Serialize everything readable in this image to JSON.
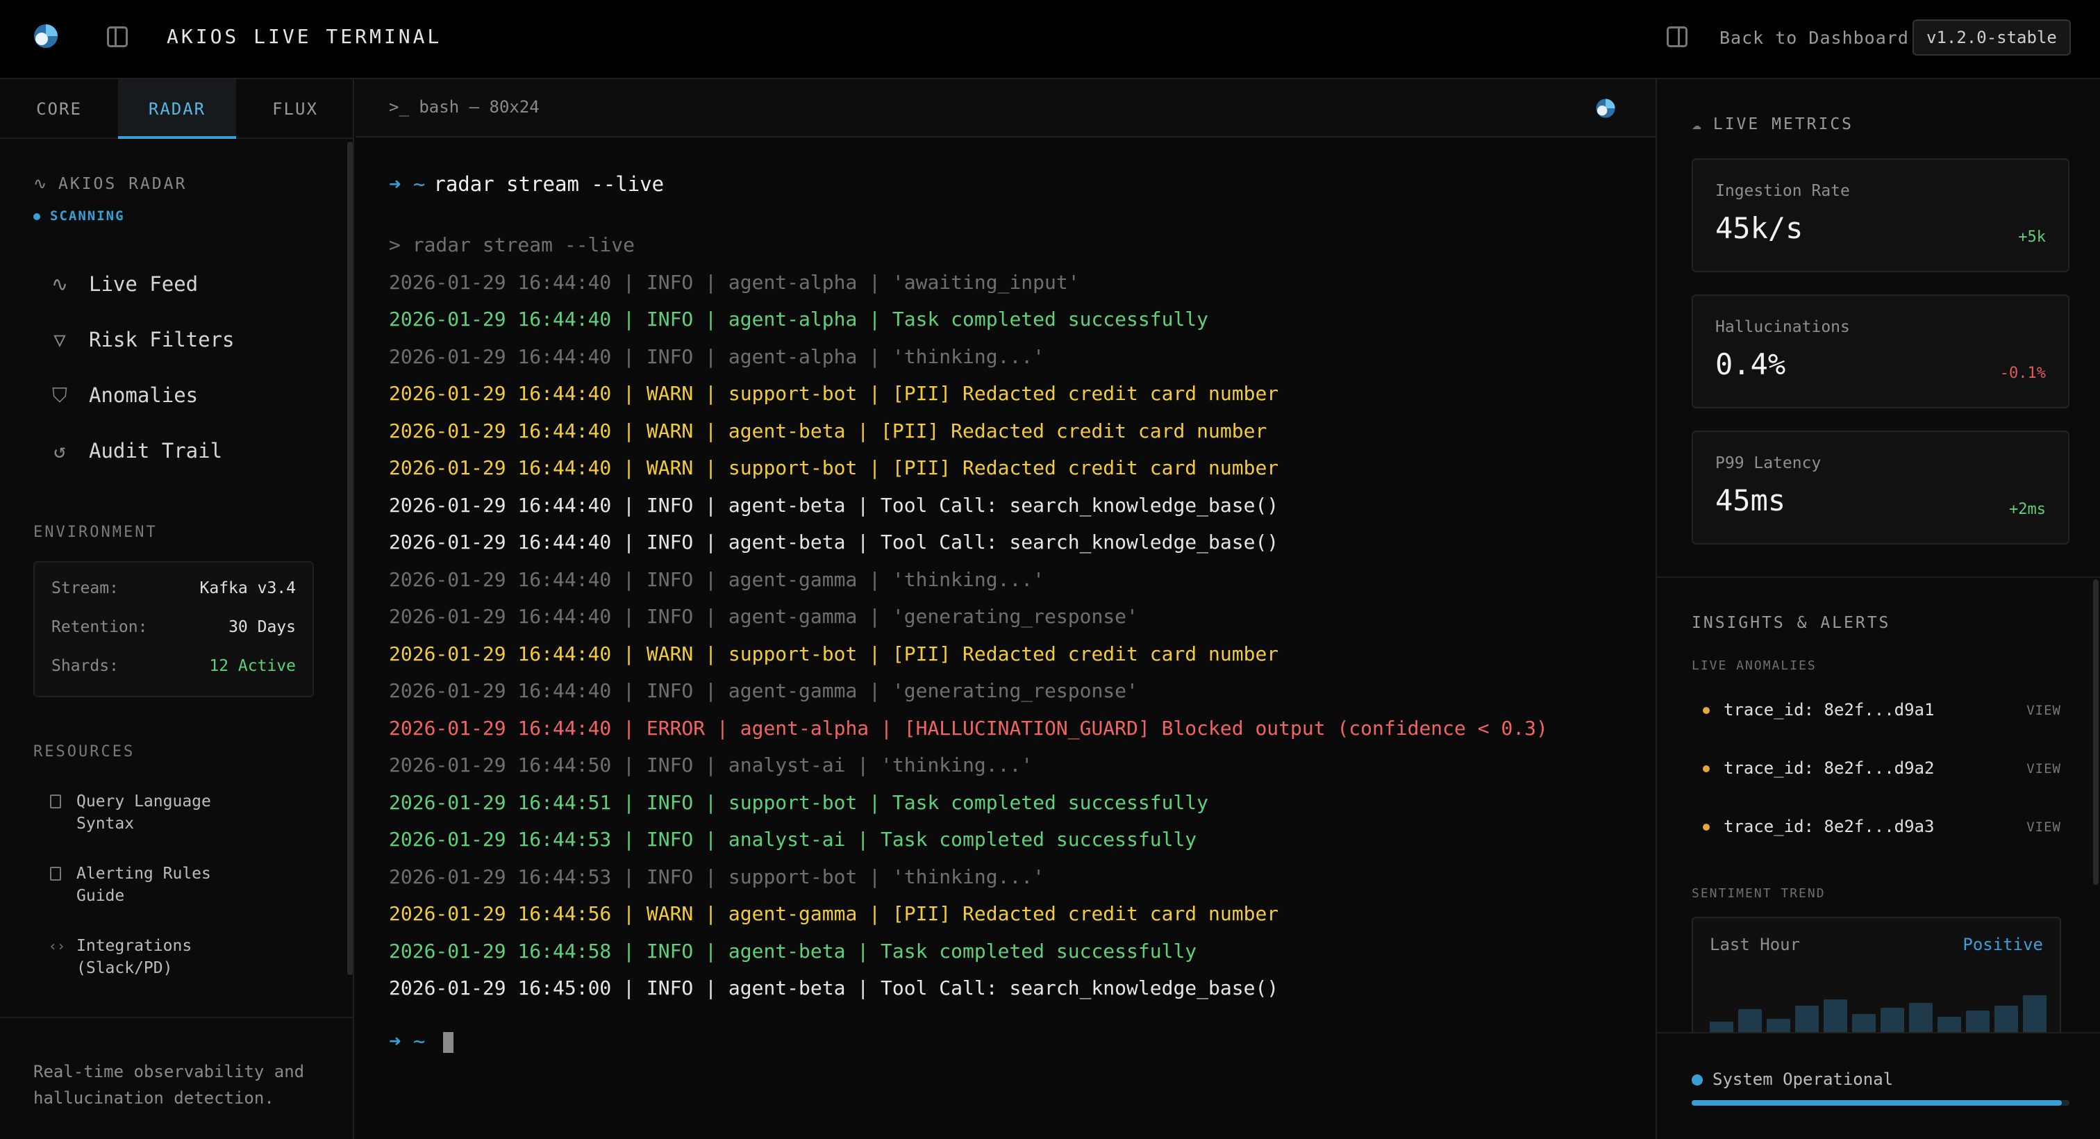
{
  "header": {
    "title": "AKIOS LIVE TERMINAL",
    "back_label": "Back to Dashboard",
    "version": "v1.2.0-stable"
  },
  "sidebar": {
    "tabs": [
      "CORE",
      "RADAR",
      "FLUX"
    ],
    "active_tab": "RADAR",
    "radar_title": "AKIOS RADAR",
    "radar_status": "SCANNING",
    "nav": [
      {
        "label": "Live Feed",
        "icon": "activity-icon"
      },
      {
        "label": "Risk Filters",
        "icon": "filter-icon"
      },
      {
        "label": "Anomalies",
        "icon": "shield-icon"
      },
      {
        "label": "Audit Trail",
        "icon": "history-icon"
      }
    ],
    "environment_label": "ENVIRONMENT",
    "environment": [
      {
        "key": "Stream:",
        "value": "Kafka v3.4"
      },
      {
        "key": "Retention:",
        "value": "30 Days"
      },
      {
        "key": "Shards:",
        "value": "12 Active"
      }
    ],
    "resources_label": "RESOURCES",
    "resources": [
      {
        "line1": "Query Language",
        "line2": "Syntax",
        "icon": "book-icon"
      },
      {
        "line1": "Alerting Rules",
        "line2": "Guide",
        "icon": "book-icon"
      },
      {
        "line1": "Integrations",
        "line2": "(Slack/PD)",
        "icon": "code-icon"
      }
    ],
    "footer": [
      "Real-time observability and",
      "hallucination detection."
    ]
  },
  "terminal": {
    "title": ">_ bash — 80x24",
    "prompt_symbol": "➜ ~",
    "command": "radar stream --live",
    "lines": [
      {
        "level": "echo",
        "text": "> radar stream --live"
      },
      {
        "level": "dim",
        "text": "2026-01-29 16:44:40 | INFO | agent-alpha | 'awaiting_input'"
      },
      {
        "level": "ok",
        "text": "2026-01-29 16:44:40 | INFO | agent-alpha | Task completed successfully"
      },
      {
        "level": "dim",
        "text": "2026-01-29 16:44:40 | INFO | agent-alpha | 'thinking...'"
      },
      {
        "level": "warn",
        "text": "2026-01-29 16:44:40 | WARN | support-bot | [PII] Redacted credit card number"
      },
      {
        "level": "warn",
        "text": "2026-01-29 16:44:40 | WARN | agent-beta | [PII] Redacted credit card number"
      },
      {
        "level": "warn",
        "text": "2026-01-29 16:44:40 | WARN | support-bot | [PII] Redacted credit card number"
      },
      {
        "level": "info",
        "text": "2026-01-29 16:44:40 | INFO | agent-beta | Tool Call: search_knowledge_base()"
      },
      {
        "level": "info",
        "text": "2026-01-29 16:44:40 | INFO | agent-beta | Tool Call: search_knowledge_base()"
      },
      {
        "level": "dim",
        "text": "2026-01-29 16:44:40 | INFO | agent-gamma | 'thinking...'"
      },
      {
        "level": "dim",
        "text": "2026-01-29 16:44:40 | INFO | agent-gamma | 'generating_response'"
      },
      {
        "level": "warn",
        "text": "2026-01-29 16:44:40 | WARN | support-bot | [PII] Redacted credit card number"
      },
      {
        "level": "dim",
        "text": "2026-01-29 16:44:40 | INFO | agent-gamma | 'generating_response'"
      },
      {
        "level": "error",
        "text": "2026-01-29 16:44:40 | ERROR | agent-alpha | [HALLUCINATION_GUARD] Blocked output (confidence < 0.3)"
      },
      {
        "level": "dim",
        "text": "2026-01-29 16:44:50 | INFO | analyst-ai | 'thinking...'"
      },
      {
        "level": "ok",
        "text": "2026-01-29 16:44:51 | INFO | support-bot | Task completed successfully"
      },
      {
        "level": "ok",
        "text": "2026-01-29 16:44:53 | INFO | analyst-ai | Task completed successfully"
      },
      {
        "level": "dim",
        "text": "2026-01-29 16:44:53 | INFO | support-bot | 'thinking...'"
      },
      {
        "level": "warn",
        "text": "2026-01-29 16:44:56 | WARN | agent-gamma | [PII] Redacted credit card number"
      },
      {
        "level": "ok",
        "text": "2026-01-29 16:44:58 | INFO | agent-beta | Task completed successfully"
      },
      {
        "level": "info",
        "text": "2026-01-29 16:45:00 | INFO | agent-beta | Tool Call: search_knowledge_base()"
      }
    ]
  },
  "right_panel": {
    "metrics_label": "LIVE METRICS",
    "metrics": [
      {
        "label": "Ingestion Rate",
        "value": "45k/s",
        "delta": "+5k",
        "trend": "pos"
      },
      {
        "label": "Hallucinations",
        "value": "0.4%",
        "delta": "-0.1%",
        "trend": "neg"
      },
      {
        "label": "P99 Latency",
        "value": "45ms",
        "delta": "+2ms",
        "trend": "pos"
      }
    ],
    "insights_label": "INSIGHTS & ALERTS",
    "anomalies_label": "LIVE ANOMALIES",
    "anomalies": [
      {
        "trace": "trace_id: 8e2f...d9a1",
        "action": "VIEW"
      },
      {
        "trace": "trace_id: 8e2f...d9a2",
        "action": "VIEW"
      },
      {
        "trace": "trace_id: 8e2f...d9a3",
        "action": "VIEW"
      }
    ],
    "trend_label": "SENTIMENT TREND",
    "trend_period": "Last Hour",
    "trend_sentiment": "Positive",
    "trend_bars": [
      0.3,
      0.5,
      0.35,
      0.55,
      0.65,
      0.42,
      0.52,
      0.6,
      0.38,
      0.48,
      0.55,
      0.72
    ],
    "status": "System Operational",
    "status_progress": 0.98
  },
  "colors": {
    "accent": "#3a9fd6",
    "ok": "#5fd17a",
    "warn": "#f2cc3a",
    "error": "#f06464"
  }
}
